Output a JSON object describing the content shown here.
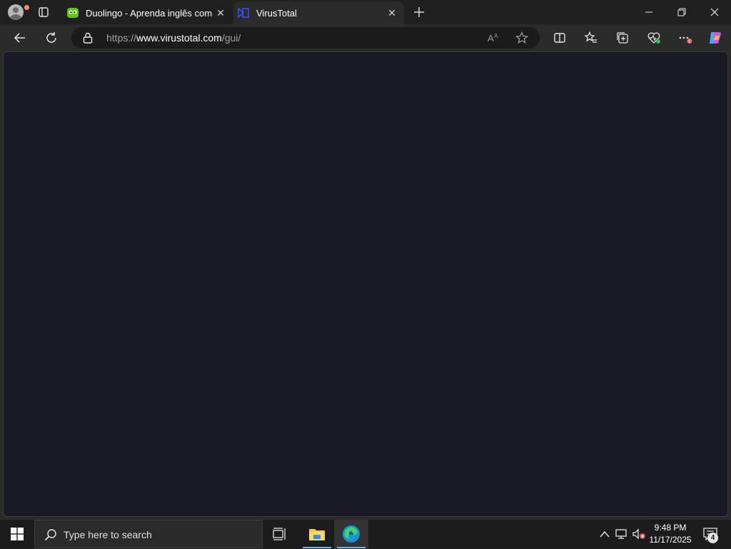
{
  "browser": {
    "tabs": [
      {
        "title": "Duolingo - Aprenda inglês com lições",
        "active": false,
        "favicon": "duolingo-owl-icon"
      },
      {
        "title": "VirusTotal",
        "active": true,
        "favicon": "virustotal-icon"
      }
    ],
    "address": {
      "scheme": "https://",
      "host": "www.virustotal.com",
      "path": "/gui/"
    }
  },
  "page": {
    "background": "#1a1926"
  },
  "taskbar": {
    "search_placeholder": "Type here to search",
    "time": "9:48 PM",
    "date": "11/17/2025",
    "notification_count": "4"
  },
  "colors": {
    "accent": "#6cb8f5",
    "duolingo_green": "#58cc02",
    "virustotal_blue": "#394eff"
  }
}
